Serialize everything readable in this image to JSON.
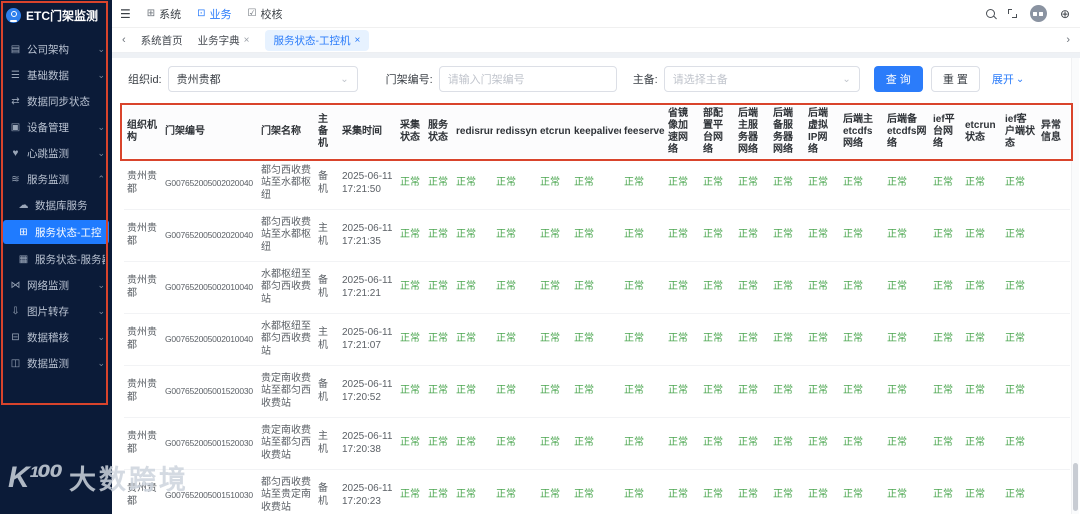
{
  "sidebar": {
    "logo_title": "ETC门架监测",
    "items": [
      {
        "label": "公司架构",
        "icon": "org-structure-icon",
        "glyph": "▤",
        "chevron": "⌄",
        "type": "main"
      },
      {
        "label": "基础数据",
        "icon": "base-data-icon",
        "glyph": "☰",
        "chevron": "⌄",
        "type": "main"
      },
      {
        "label": "数据同步状态",
        "icon": "data-sync-icon",
        "glyph": "⇄",
        "chevron": "",
        "type": "main"
      },
      {
        "label": "设备管理",
        "icon": "device-management-icon",
        "glyph": "▣",
        "chevron": "⌄",
        "type": "main"
      },
      {
        "label": "心跳监测",
        "icon": "heartbeat-monitor-icon",
        "glyph": "♥",
        "chevron": "⌄",
        "type": "main"
      },
      {
        "label": "服务监测",
        "icon": "service-monitor-icon",
        "glyph": "≋",
        "chevron": "⌃",
        "type": "main"
      },
      {
        "label": "数据库服务",
        "icon": "database-service-icon",
        "glyph": "☁",
        "chevron": "",
        "type": "sub"
      },
      {
        "label": "服务状态-工控机",
        "icon": "service-status-ipc-icon",
        "glyph": "⊞",
        "chevron": "",
        "type": "sub",
        "active": true
      },
      {
        "label": "服务状态-服务器",
        "icon": "service-status-server-icon",
        "glyph": "▦",
        "chevron": "",
        "type": "sub"
      },
      {
        "label": "网络监测",
        "icon": "network-monitor-icon",
        "glyph": "⋈",
        "chevron": "⌄",
        "type": "main"
      },
      {
        "label": "图片转存",
        "icon": "image-transfer-icon",
        "glyph": "⇩",
        "chevron": "⌄",
        "type": "main"
      },
      {
        "label": "数据稽核",
        "icon": "data-audit-icon",
        "glyph": "⊟",
        "chevron": "⌄",
        "type": "main"
      },
      {
        "label": "数据监测",
        "icon": "data-monitor-icon",
        "glyph": "◫",
        "chevron": "⌄",
        "type": "main"
      }
    ]
  },
  "topbar": {
    "menus": [
      {
        "label": "系统",
        "glyph": "⊞"
      },
      {
        "label": "业务",
        "glyph": "⊡",
        "active": true
      },
      {
        "label": "校核",
        "glyph": "☑"
      }
    ]
  },
  "tabs": [
    {
      "label": "系统首页",
      "closable": false
    },
    {
      "label": "业务字典",
      "closable": true
    },
    {
      "label": "服务状态-工控机",
      "closable": true,
      "active": true
    }
  ],
  "tabbar": {
    "back_chevron": "‹",
    "forward_chevron": "›",
    "close_glyph": "×"
  },
  "filters": {
    "org_label": "组织id:",
    "org_value": "贵州贵都",
    "gantry_label": "门架编号:",
    "gantry_placeholder": "请输入门架编号",
    "mode_label": "主备:",
    "mode_placeholder": "请选择主备",
    "search_label": "查 询",
    "reset_label": "重 置",
    "expand_label": "展开",
    "chevron": "⌄"
  },
  "table": {
    "columns": [
      "组织机构",
      "门架编号",
      "门架名称",
      "主备机",
      "采集时间",
      "采集状态",
      "服务状态",
      "redisrun",
      "redissync",
      "etcrun",
      "keepalived",
      "feeserver",
      "省镜像加速网络",
      "部配置平台网络",
      "后端主服务器网络",
      "后端备服务器网络",
      "后端虚拟IP网络",
      "后端主etcdfs网络",
      "后端备etcdfs网络",
      "ief平台网络",
      "etcrun状态",
      "ief客户端状态",
      "异常信息"
    ],
    "status_ok": "正常",
    "error_info_empty": "",
    "rows": [
      {
        "org": "贵州贵都",
        "gantry_id": "G007652005002020040",
        "gantry_name": "都匀西收费站至水都枢纽",
        "mode": "备机",
        "time": "2025-06-11 17:21:50"
      },
      {
        "org": "贵州贵都",
        "gantry_id": "G007652005002020040",
        "gantry_name": "都匀西收费站至水都枢纽",
        "mode": "主机",
        "time": "2025-06-11 17:21:35"
      },
      {
        "org": "贵州贵都",
        "gantry_id": "G007652005002010040",
        "gantry_name": "水都枢纽至都匀西收费站",
        "mode": "备机",
        "time": "2025-06-11 17:21:21"
      },
      {
        "org": "贵州贵都",
        "gantry_id": "G007652005002010040",
        "gantry_name": "水都枢纽至都匀西收费站",
        "mode": "主机",
        "time": "2025-06-11 17:21:07"
      },
      {
        "org": "贵州贵都",
        "gantry_id": "G007652005001520030",
        "gantry_name": "贵定南收费站至都匀西收费站",
        "mode": "备机",
        "time": "2025-06-11 17:20:52"
      },
      {
        "org": "贵州贵都",
        "gantry_id": "G007652005001520030",
        "gantry_name": "贵定南收费站至都匀西收费站",
        "mode": "主机",
        "time": "2025-06-11 17:20:38"
      },
      {
        "org": "贵州贵都",
        "gantry_id": "G007652005001510030",
        "gantry_name": "都匀西收费站至贵定南收费站",
        "mode": "备机",
        "time": "2025-06-11 17:20:23"
      }
    ]
  },
  "watermark": {
    "mark": "K¹⁰⁰",
    "text": "大数跨境"
  },
  "colors": {
    "accent_blue": "#2b7cfa",
    "status_green": "#49a54e",
    "annotation_red": "#d9442c",
    "sidebar_bg": "#0b1b38"
  }
}
